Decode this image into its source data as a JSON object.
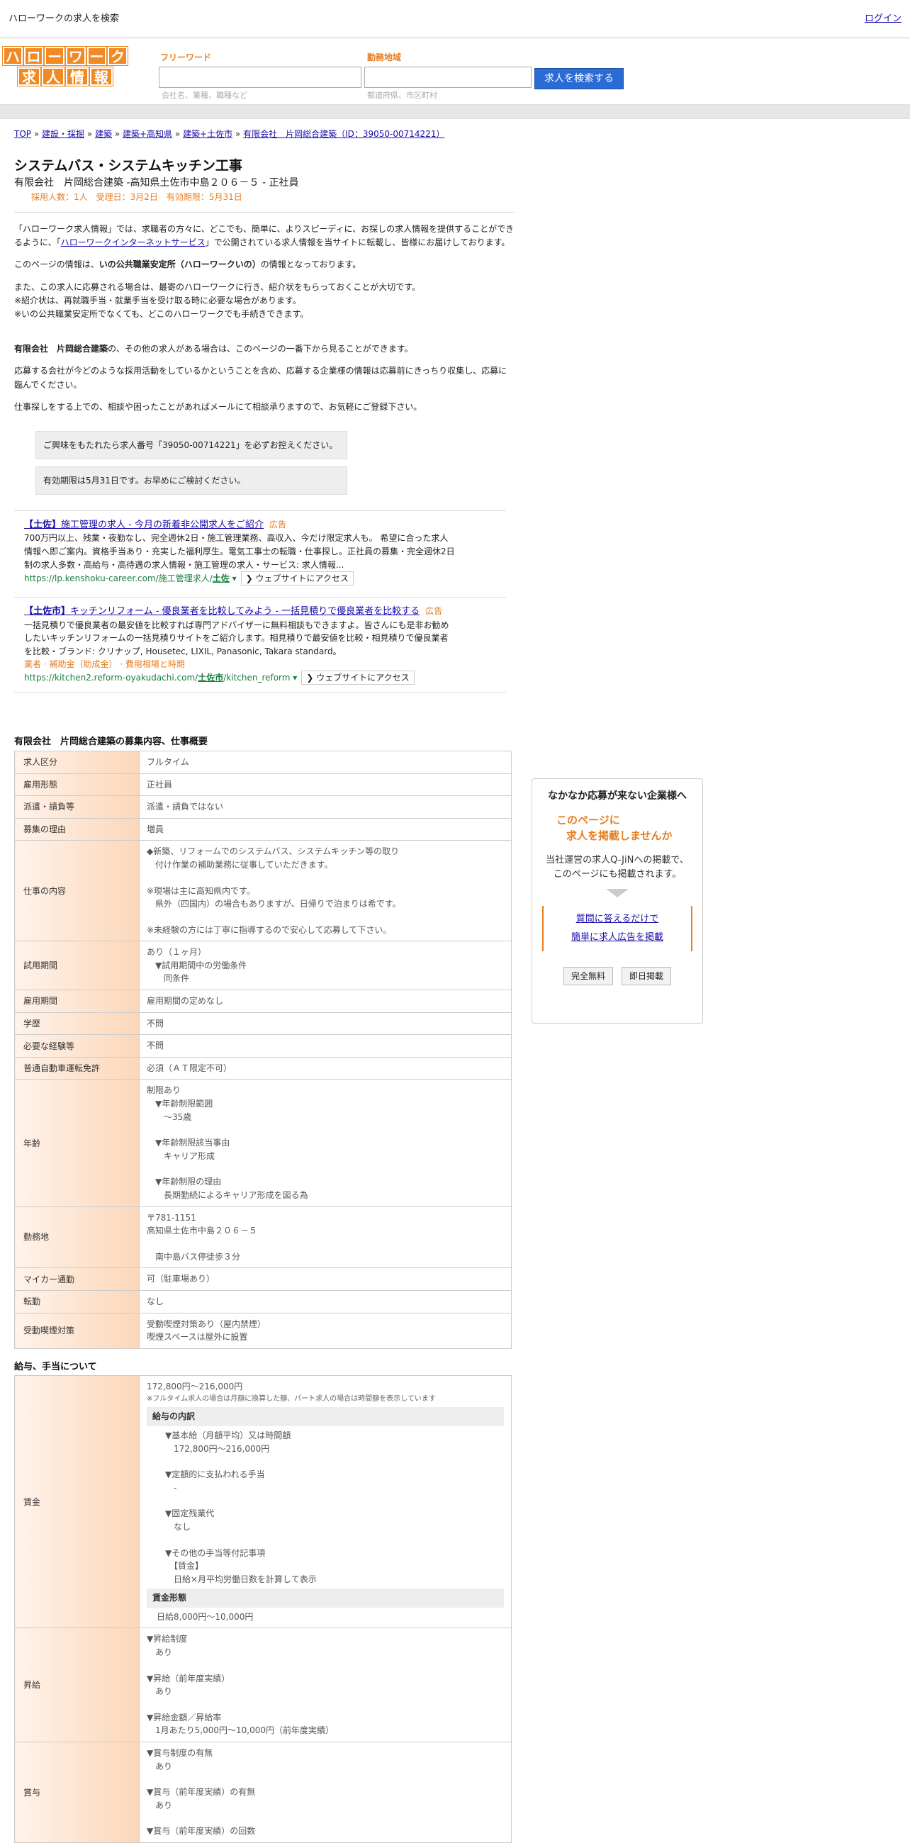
{
  "topbar": {
    "title": "ハローワークの求人を検索",
    "login": "ログイン"
  },
  "logo": {
    "row1": [
      "ハ",
      "ロ",
      "ー",
      "ワ",
      "ー",
      "ク"
    ],
    "row2": [
      "求",
      "人",
      "情",
      "報"
    ]
  },
  "search": {
    "keyword_label": "フリーワード",
    "keyword_hint": "会社名、業種、職種など",
    "area_label": "勤務地域",
    "area_hint": "都道府県、市区町村",
    "button": "求人を検索する"
  },
  "breadcrumb": [
    "TOP",
    "建設・採掘",
    "建築",
    "建築+高知県",
    "建築+土佐市",
    "有限会社　片岡総合建築（ID：39050-00714221）"
  ],
  "job": {
    "title": "システムバス・システムキッチン工事",
    "subtitle": "有限会社　片岡総合建築 -高知県土佐市中島２０６－５ - 正社員",
    "info": "採用人数：1人　受理日：3月2日　有効期限：5月31日"
  },
  "intro": {
    "p1a": "「ハローワーク求人情報」では、求職者の方々に、どこでも、簡単に、よりスピーディに、お探しの求人情報を提供することができるように、「",
    "p1link": "ハローワークインターネットサービス",
    "p1b": "」で公開されている求人情報を当サイトに転載し、皆様にお届けしております。",
    "p2a": "このページの情報は、",
    "p2b": "いの公共職業安定所（ハローワークいの）",
    "p2c": "の情報となっております。",
    "p3": "また、この求人に応募される場合は、最寄のハローワークに行き、紹介状をもらっておくことが大切です。",
    "p3b": "※紹介状は、再就職手当・就業手当を受け取る時に必要な場合があります。",
    "p3c": "※いの公共職業安定所でなくても、どこのハローワークでも手続きできます。",
    "p4a": "有限会社　片岡総合建築",
    "p4b": "の、その他の求人がある場合は、このページの一番下から見ることができます。",
    "p5": "応募する会社が今どのような採用活動をしているかということを含め、応募する企業様の情報は応募前にきっちり収集し、応募に臨んでください。",
    "p6": "仕事探しをする上での、相談や困ったことがあればメールにて相談承りますので、お気軽にご登録下さい。"
  },
  "notices": [
    "ご興味をもたれたら求人番号「39050-00714221」を必ずお控えください。",
    "有効期限は5月31日です。お早めにご検討ください。"
  ],
  "ads": [
    {
      "title_bold": "【土佐】",
      "title": "施工管理の求人 - 今月の新着非公開求人をご紹介",
      "tag": "広告",
      "body": "700万円以上、残業・夜勤なし、完全週休2日・施工管理業務、高収入、今だけ限定求人も。 希望に合った求人情報へ即ご案内。資格手当あり・充実した福利厚生。電気工事士の転職・仕事探し。正社員の募集・完全週休2日制の求人多数・高給与・高待遇の求人情報・施工管理の求人・サービス: 求人情報...",
      "extra": "",
      "url_a": "https://lp.kenshoku-career.com/施工管理求人/",
      "url_b": "土佐",
      "url_c": "",
      "btn": "❯ ウェブサイトにアクセス"
    },
    {
      "title_bold": "【土佐市】",
      "title": "キッチンリフォーム - 優良業者を比較してみよう - 一括見積りで優良業者を比較する",
      "tag": "広告",
      "body": "一括見積りで優良業者の最安値を比較すれば専門アドバイザーに無料相談もできますよ。皆さんにも是非お勧めしたいキッチンリフォームの一括見積りサイトをご紹介します。相見積りで最安値を比較・相見積りで優良業者を比較・ブランド: クリナップ, Housetec, LIXIL, Panasonic, Takara standard。",
      "extra": "業者 · 補助金（助成金） · 費用相場と時期",
      "url_a": "https://kitchen2.reform-oyakudachi.com/",
      "url_b": "土佐市",
      "url_c": "/kitchen_reform",
      "btn": "❯ ウェブサイトにアクセス"
    }
  ],
  "recruit": {
    "title": "有限会社　片岡総合建築の募集内容、仕事概要",
    "rows": [
      {
        "label": "求人区分",
        "lines": [
          "フルタイム"
        ]
      },
      {
        "label": "雇用形態",
        "lines": [
          "正社員"
        ]
      },
      {
        "label": "派遣・請負等",
        "lines": [
          "派遣・請負ではない"
        ]
      },
      {
        "label": "募集の理由",
        "lines": [
          "増員"
        ]
      },
      {
        "label": "仕事の内容",
        "lines": [
          "◆新築、リフォームでのシステムバス、システムキッチン等の取り",
          "　付け作業の補助業務に従事していただきます。",
          "",
          "※現場は主に高知県内です。",
          "　県外（四国内）の場合もありますが、日帰りで泊まりは希です。",
          "",
          "※未経験の方には丁寧に指導するので安心して応募して下さい。"
        ]
      },
      {
        "label": "試用期間",
        "lines": [
          "あり（１ヶ月）",
          "　▼試用期間中の労働条件",
          "　　同条件"
        ]
      },
      {
        "label": "雇用期間",
        "lines": [
          "雇用期間の定めなし"
        ]
      },
      {
        "label": "学歴",
        "lines": [
          "不問"
        ]
      },
      {
        "label": "必要な経験等",
        "lines": [
          "不問"
        ]
      },
      {
        "label": "普通自動車運転免許",
        "lines": [
          "必須（ＡＴ限定不可）"
        ]
      },
      {
        "label": "年齢",
        "lines": [
          "制限あり",
          "　▼年齢制限範囲",
          "　　〜35歳",
          "",
          "　▼年齢制限該当事由",
          "　　キャリア形成",
          "",
          "　▼年齢制限の理由",
          "　　長期勤続によるキャリア形成を図る為"
        ]
      },
      {
        "label": "勤務地",
        "lines": [
          "〒781-1151",
          "高知県土佐市中島２０６－５",
          "",
          "　南中島バス停徒歩３分"
        ]
      },
      {
        "label": "マイカー通勤",
        "lines": [
          "可（駐車場あり）"
        ]
      },
      {
        "label": "転勤",
        "lines": [
          "なし"
        ]
      },
      {
        "label": "受動喫煙対策",
        "lines": [
          "受動喫煙対策あり（屋内禁煙）",
          "喫煙スペースは屋外に設置"
        ]
      }
    ]
  },
  "salary": {
    "title": "給与、手当について",
    "wage_label": "賃金",
    "wage_range": "172,800円〜216,000円",
    "wage_note": "※フルタイム求人の場合は月額に換算した額、パート求人の場合は時間額を表示しています",
    "breakdown_head": "給与の内訳",
    "breakdown": [
      "▼基本給（月額平均）又は時間額",
      "　172,800円〜216,000円",
      "",
      "▼定額的に支払われる手当",
      "　-",
      "",
      "▼固定残業代",
      "　なし",
      "",
      "▼その他の手当等付記事項",
      "　【賃金】",
      "　日給×月平均労働日数を計算して表示"
    ],
    "form_head": "賃金形態",
    "form": "日給8,000円〜10,000円",
    "raise_label": "昇給",
    "raise": [
      "▼昇給制度",
      "　あり",
      "",
      "▼昇給（前年度実績）",
      "　あり",
      "",
      "▼昇給金額／昇給率",
      "　1月あたり5,000円〜10,000円（前年度実績）"
    ],
    "bonus_label": "賞与",
    "bonus": [
      "▼賞与制度の有無",
      "　あり",
      "",
      "▼賞与（前年度実績）の有無",
      "　あり",
      "",
      "▼賞与（前年度実績）の回数"
    ]
  },
  "side": {
    "title": "なかなか応募が来ない企業様へ",
    "org1": "このページに",
    "org2": "求人を掲載しませんか",
    "text1": "当社運営の求人Q-JiNへの掲載で、",
    "text2": "このページにも掲載されます。",
    "link1": "質問に答えるだけで",
    "link2": "簡単に求人広告を掲載",
    "btn1": "完全無料",
    "btn2": "即日掲載"
  }
}
